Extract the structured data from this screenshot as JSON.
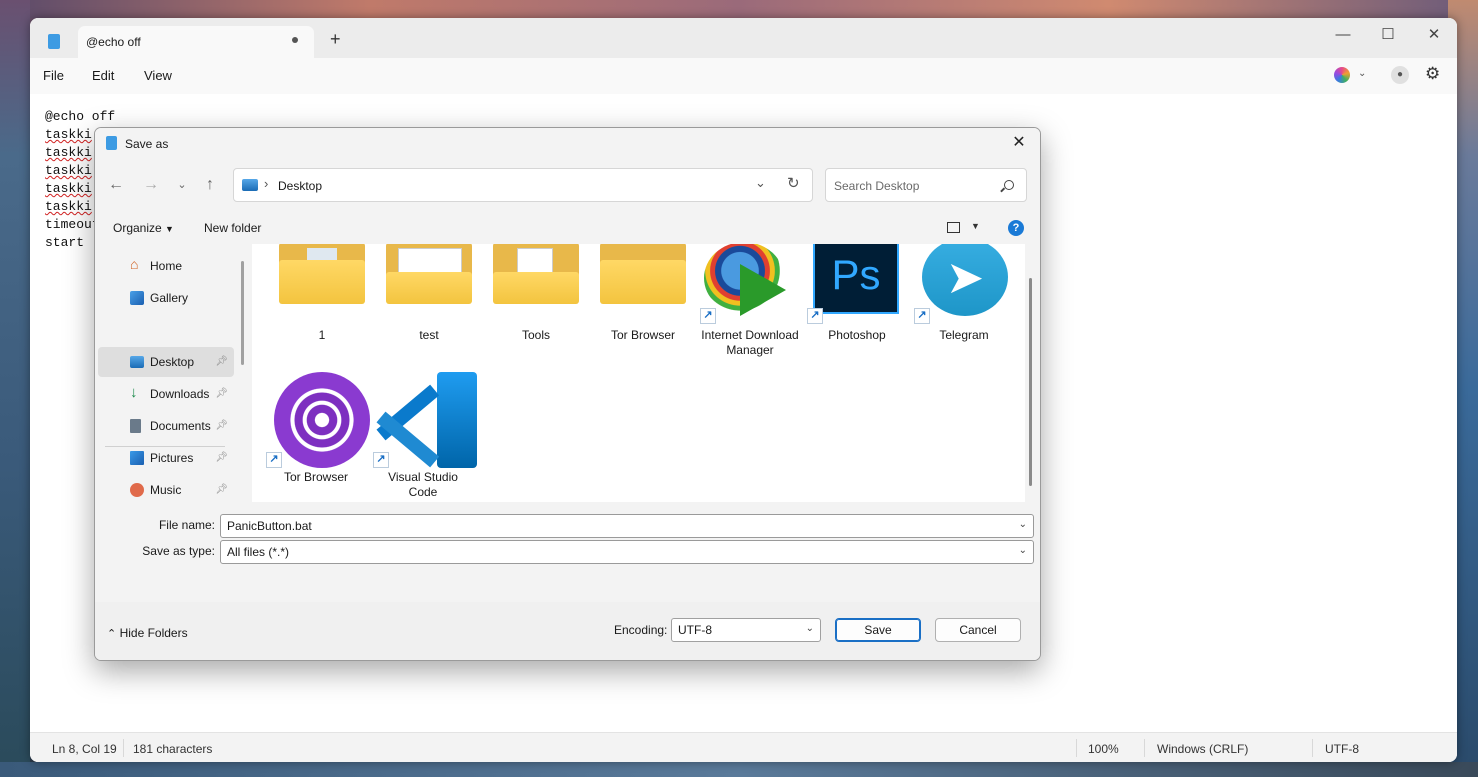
{
  "notepad": {
    "tab_title": "@echo off",
    "new_tab": "+",
    "window_controls": {
      "minimize": "—",
      "maximize": "☐",
      "close": "✕"
    },
    "menu": [
      "File",
      "Edit",
      "View"
    ],
    "editor_lines": [
      {
        "text": "@echo off",
        "squiggle": false
      },
      {
        "text": "taskki",
        "squiggle": true
      },
      {
        "text": "taskki",
        "squiggle": true
      },
      {
        "text": "taskki",
        "squiggle": true
      },
      {
        "text": "taskki",
        "squiggle": true
      },
      {
        "text": "taskki",
        "squiggle": true
      },
      {
        "text": "timeout",
        "squiggle": false
      },
      {
        "text": "start ",
        "squiggle": false
      }
    ],
    "status": {
      "position": "Ln 8, Col 19",
      "characters": "181 characters",
      "zoom": "100%",
      "line_ending": "Windows (CRLF)",
      "encoding": "UTF-8"
    }
  },
  "dialog": {
    "title": "Save as",
    "close": "✕",
    "address": {
      "separator": "›",
      "location": "Desktop"
    },
    "search": {
      "placeholder": "Search Desktop"
    },
    "toolbar": {
      "organize": "Organize",
      "new_folder": "New folder",
      "help": "?"
    },
    "nav_items": [
      {
        "label": "Home",
        "icon": "home-icon",
        "pinned": false,
        "selected": false
      },
      {
        "label": "Gallery",
        "icon": "gallery-icon",
        "pinned": false,
        "selected": false
      },
      {
        "label": "Desktop",
        "icon": "desktop-icon",
        "pinned": true,
        "selected": true
      },
      {
        "label": "Downloads",
        "icon": "download-icon",
        "pinned": true,
        "selected": false
      },
      {
        "label": "Documents",
        "icon": "documents-icon",
        "pinned": true,
        "selected": false
      },
      {
        "label": "Pictures",
        "icon": "pictures-icon",
        "pinned": true,
        "selected": false
      },
      {
        "label": "Music",
        "icon": "music-icon",
        "pinned": true,
        "selected": false
      }
    ],
    "files": [
      {
        "label": "1",
        "kind": "folder"
      },
      {
        "label": "test",
        "kind": "folder"
      },
      {
        "label": "Tools",
        "kind": "folder"
      },
      {
        "label": "Tor Browser",
        "kind": "folder"
      },
      {
        "label": "Internet Download Manager",
        "kind": "shortcut"
      },
      {
        "label": "Photoshop",
        "kind": "shortcut"
      },
      {
        "label": "Telegram",
        "kind": "shortcut"
      },
      {
        "label": "Tor Browser",
        "kind": "shortcut"
      },
      {
        "label": "Visual Studio Code",
        "kind": "shortcut"
      }
    ],
    "file_name": {
      "label": "File name:",
      "value": "PanicButton.bat"
    },
    "save_type": {
      "label": "Save as type:",
      "value": "All files  (*.*)"
    },
    "footer": {
      "hide_folders": "Hide Folders",
      "encoding_label": "Encoding:",
      "encoding_value": "UTF-8",
      "save": "Save",
      "cancel": "Cancel"
    }
  }
}
